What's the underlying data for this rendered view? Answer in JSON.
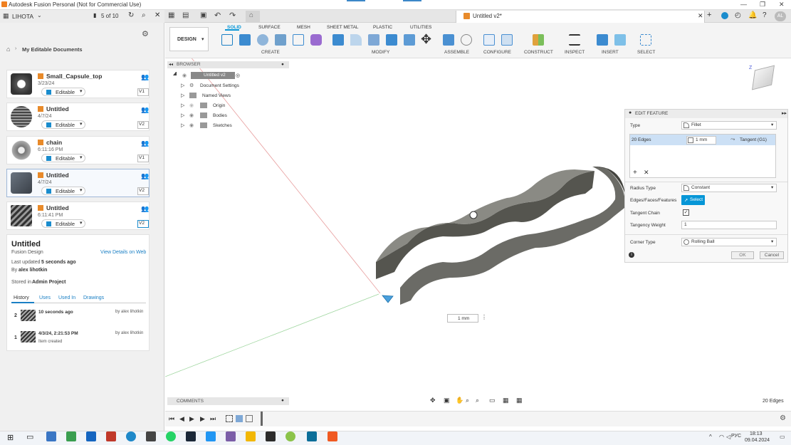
{
  "window": {
    "title": "Autodesk Fusion Personal (Not for Commercial Use)"
  },
  "topbar": {
    "team": "LIHOTA",
    "doc_count": "5 of 10",
    "tab_title": "Untitled v2*",
    "user_initials": "AL"
  },
  "left_panel": {
    "breadcrumb": "My Editable Documents",
    "files": [
      {
        "name": "Small_Capsule_top",
        "date": "3/23/24",
        "status": "Editable",
        "version": "V1"
      },
      {
        "name": "Untitled",
        "date": "4/7/24",
        "status": "Editable",
        "version": "V2"
      },
      {
        "name": "chain",
        "date": "6:11:16 PM",
        "status": "Editable",
        "version": "V1"
      },
      {
        "name": "Untitled",
        "date": "4/7/24",
        "status": "Editable",
        "version": "V2"
      },
      {
        "name": "Untitled",
        "date": "6:11:41 PM",
        "status": "Editable",
        "version": "V2"
      }
    ],
    "info": {
      "title": "Untitled",
      "subtitle": "Fusion Design",
      "view_link": "View Details on Web",
      "updated_label": "Last updated",
      "updated_value": "5 seconds ago",
      "by_label": "By",
      "by_value": "alex lihotkin",
      "stored_label": "Stored in",
      "stored_value": "Admin Project",
      "tabs": [
        "History",
        "Uses",
        "Used In",
        "Drawings"
      ],
      "history": [
        {
          "num": "2",
          "time": "10 seconds ago",
          "by": "by alex lihotkin",
          "note": ""
        },
        {
          "num": "1",
          "time": "4/3/24, 2:21:53 PM",
          "by": "by alex lihotkin",
          "note": "Item created"
        }
      ]
    }
  },
  "toolbar": {
    "design": "DESIGN",
    "tabs": [
      "SOLID",
      "SURFACE",
      "MESH",
      "SHEET METAL",
      "PLASTIC",
      "UTILITIES"
    ],
    "groups": [
      "CREATE",
      "MODIFY",
      "ASSEMBLE",
      "CONFIGURE",
      "CONSTRUCT",
      "INSPECT",
      "INSERT",
      "SELECT"
    ]
  },
  "browser": {
    "title": "BROWSER",
    "root": "Untitled v2",
    "items": [
      "Document Settings",
      "Named Views",
      "Origin",
      "Bodies",
      "Sketches"
    ]
  },
  "edit_feature": {
    "title": "EDIT FEATURE",
    "type_label": "Type",
    "type_value": "Fillet",
    "edges_label": "20 Edges",
    "edge_value": "1 mm",
    "continuity": "Tangent (G1)",
    "radius_type_label": "Radius Type",
    "radius_type_value": "Constant",
    "eff_label": "Edges/Faces/Features",
    "select_btn": "Select",
    "tangent_chain_label": "Tangent Chain",
    "tangency_weight_label": "Tangency Weight",
    "tangency_weight_value": "1",
    "corner_type_label": "Corner Type",
    "corner_type_value": "Rolling Ball",
    "ok": "OK",
    "cancel": "Cancel"
  },
  "viewport": {
    "dim_input": "1 mm",
    "edges_count": "20 Edges",
    "comments": "COMMENTS"
  },
  "taskbar": {
    "lang": "РУС",
    "time": "18:13",
    "date": "09.04.2024"
  },
  "colors": {
    "accent": "#0696d7",
    "body": "#6b6b66"
  }
}
